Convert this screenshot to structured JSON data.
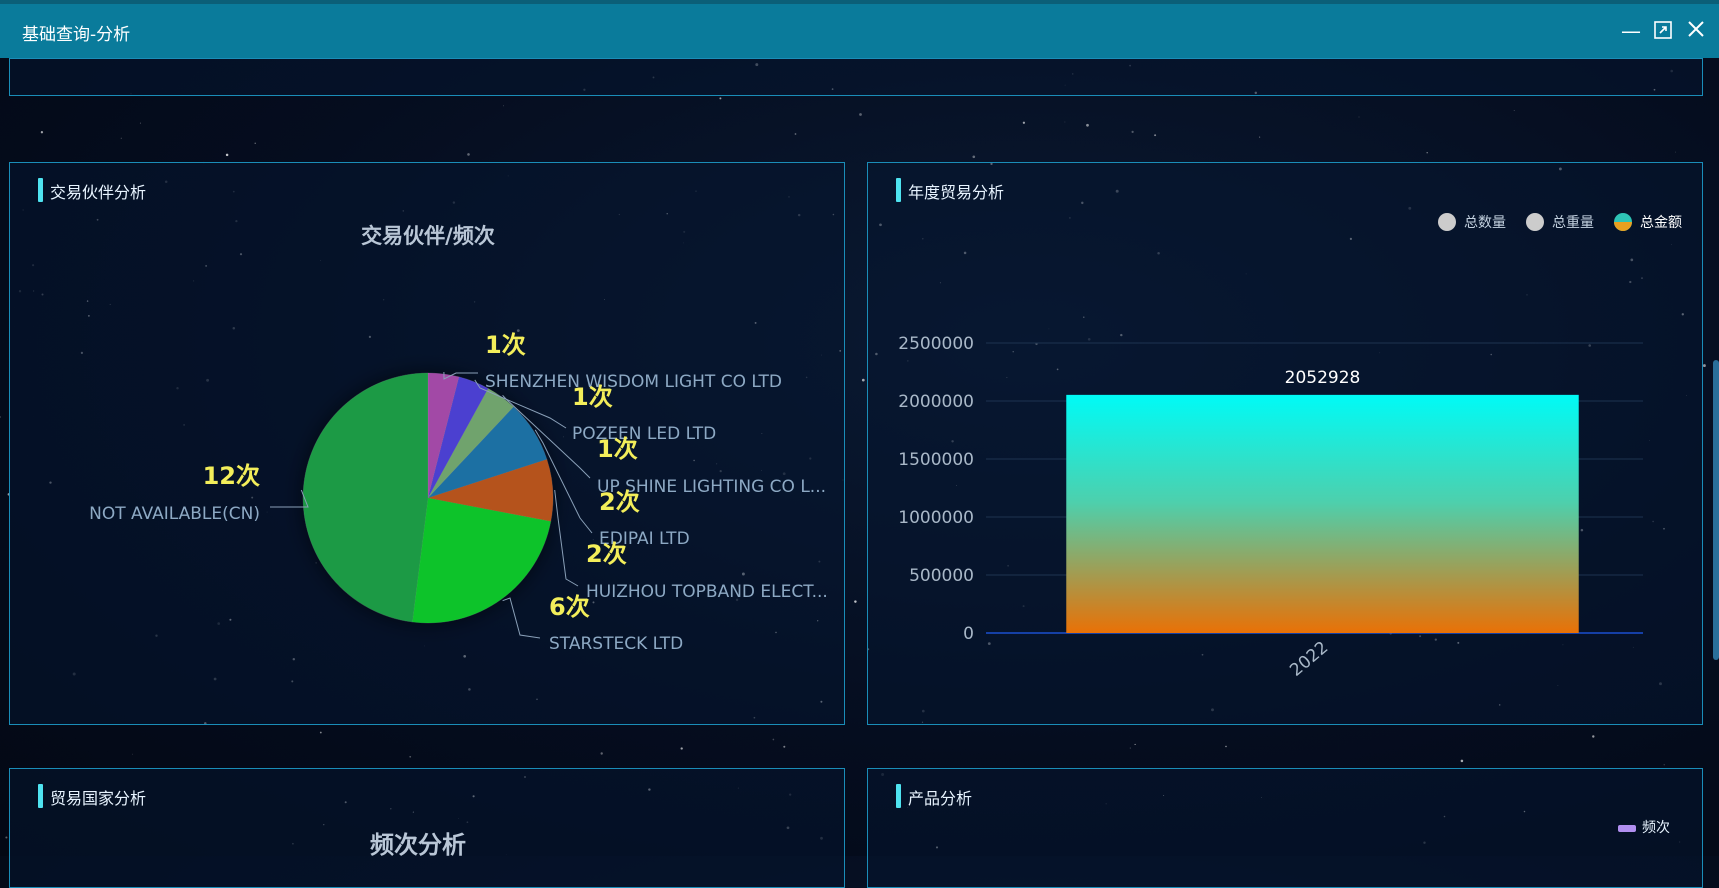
{
  "window": {
    "title": "基础查询-分析",
    "minimize_icon": "minimize-icon",
    "maximize_icon": "maximize-icon",
    "close_icon": "close-icon"
  },
  "partner_panel": {
    "title": "交易伙伴分析",
    "chart_data": {
      "type": "pie",
      "title": "交易伙伴/频次",
      "slices": [
        {
          "label": "SHENZHEN WISDOM LIGHT CO LTD",
          "value": 1,
          "value_label": "1次",
          "color": "#a24aa6"
        },
        {
          "label": "POZEEN LED LTD",
          "value": 1,
          "value_label": "1次",
          "color": "#4b3fd0"
        },
        {
          "label": "UP SHINE LIGHTING CO L...",
          "value": 1,
          "value_label": "1次",
          "color": "#6fa36d"
        },
        {
          "label": "EDIPAI LTD",
          "value": 2,
          "value_label": "2次",
          "color": "#1f6fa3"
        },
        {
          "label": "HUIZHOU TOPBAND ELECT...",
          "value": 2,
          "value_label": "2次",
          "color": "#b5521a"
        },
        {
          "label": "STARSTECK LTD",
          "value": 6,
          "value_label": "6次",
          "color": "#0fc32a"
        },
        {
          "label": "NOT AVAILABLE(CN)",
          "value": 12,
          "value_label": "12次",
          "color": "#1f9a45"
        }
      ]
    }
  },
  "annual_panel": {
    "title": "年度贸易分析",
    "legend": [
      {
        "label": "总数量",
        "color": "#cccccc"
      },
      {
        "label": "总重量",
        "color": "#cccccc"
      },
      {
        "label": "总金额",
        "color": "#20c8d0"
      }
    ],
    "chart_data": {
      "type": "bar",
      "categories": [
        "2022"
      ],
      "series": [
        {
          "name": "总金额",
          "values": [
            2052928
          ]
        }
      ],
      "value_labels": [
        "2052928"
      ],
      "yticks": [
        "0",
        "500000",
        "1000000",
        "1500000",
        "2000000",
        "2500000"
      ],
      "ylim": [
        0,
        2500000
      ],
      "bar_gradient": [
        "#00fbf6",
        "#e97106"
      ]
    }
  },
  "country_panel": {
    "title": "贸易国家分析",
    "chart_title": "频次分析"
  },
  "product_panel": {
    "title": "产品分析",
    "legend_label": "频次",
    "legend_color": "#b18ff0"
  }
}
